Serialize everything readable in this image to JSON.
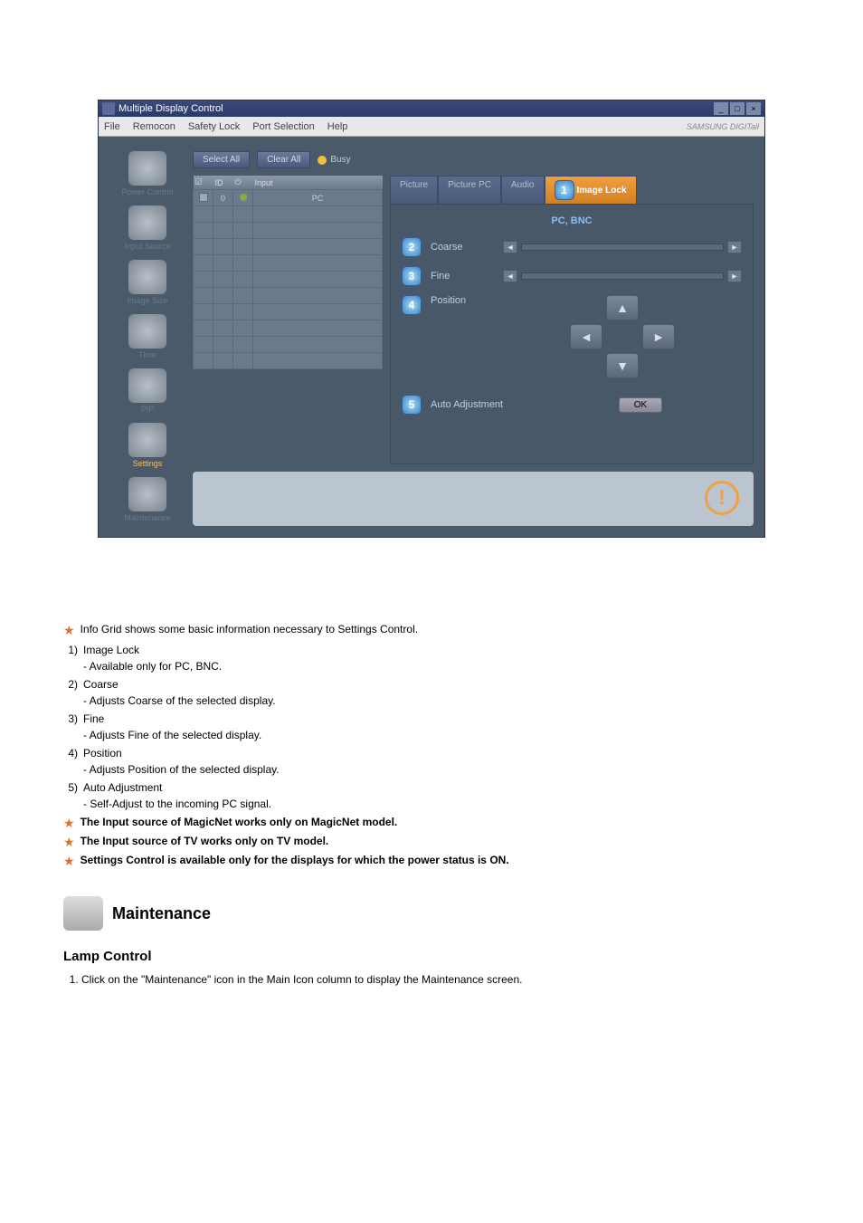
{
  "window": {
    "title": "Multiple Display Control",
    "brand": "SAMSUNG DIGITall"
  },
  "menu": {
    "file": "File",
    "remocon": "Remocon",
    "safety_lock": "Safety Lock",
    "port_selection": "Port Selection",
    "help": "Help"
  },
  "sidebar": {
    "items": [
      {
        "label": "Power Control",
        "icon": "power-icon"
      },
      {
        "label": "Input Source",
        "icon": "input-icon"
      },
      {
        "label": "Image Size",
        "icon": "size-icon"
      },
      {
        "label": "Time",
        "icon": "time-icon"
      },
      {
        "label": "PIP",
        "icon": "pip-icon"
      },
      {
        "label": "Settings",
        "icon": "settings-icon"
      },
      {
        "label": "Maintenance",
        "icon": "maintenance-icon"
      }
    ],
    "active_index": 5
  },
  "toolbar": {
    "select_all": "Select All",
    "clear_all": "Clear All",
    "busy": "Busy"
  },
  "grid": {
    "headers": [
      "",
      "ID",
      "",
      "Input"
    ],
    "rows": [
      {
        "selected": true,
        "id": "0",
        "on": true,
        "input": "PC"
      }
    ],
    "empty_rows": 10,
    "first_subcol": "Input"
  },
  "tabs": {
    "items": [
      "Picture",
      "Picture PC",
      "Audio",
      "Image Lock"
    ],
    "active_index": 3,
    "marker": "1"
  },
  "panel": {
    "heading": "PC, BNC",
    "coarse": {
      "label": "Coarse",
      "marker": "2"
    },
    "fine": {
      "label": "Fine",
      "marker": "3"
    },
    "position": {
      "label": "Position",
      "marker": "4"
    },
    "auto": {
      "label": "Auto Adjustment",
      "marker": "5",
      "ok": "OK"
    }
  },
  "doc": {
    "intro": "Info Grid shows some basic information necessary to Settings Control.",
    "items": [
      {
        "n": "1)",
        "title": "Image Lock",
        "note": "- Available only for PC, BNC."
      },
      {
        "n": "2)",
        "title": "Coarse",
        "note": "- Adjusts Coarse of the selected display."
      },
      {
        "n": "3)",
        "title": "Fine",
        "note": "- Adjusts Fine of the selected display."
      },
      {
        "n": "4)",
        "title": "Position",
        "note": "- Adjusts Position of the selected display."
      },
      {
        "n": "5)",
        "title": "Auto Adjustment",
        "note": "- Self-Adjust to the incoming PC signal."
      }
    ],
    "notes": [
      "The Input source of MagicNet works only on MagicNet model.",
      "The Input source of TV works only on TV model.",
      "Settings Control is available only for the displays for which the power status is ON."
    ],
    "section": "Maintenance",
    "subtitle": "Lamp Control",
    "step1": "Click on the \"Maintenance\" icon in the Main Icon column to display the Maintenance screen."
  }
}
